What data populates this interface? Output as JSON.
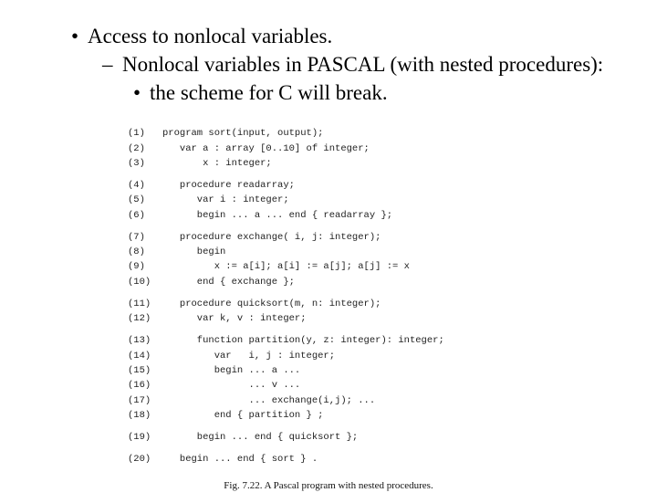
{
  "bullets": {
    "l1": "Access to nonlocal variables.",
    "l2": "Nonlocal variables in PASCAL (with nested procedures):",
    "l3": "the scheme for C will break."
  },
  "code": {
    "g1": [
      {
        "n": "(1)",
        "t": "program sort(input, output);"
      },
      {
        "n": "(2)",
        "t": "   var a : array [0..10] of integer;"
      },
      {
        "n": "(3)",
        "t": "       x : integer;"
      }
    ],
    "g2": [
      {
        "n": "(4)",
        "t": "   procedure readarray;"
      },
      {
        "n": "(5)",
        "t": "      var i : integer;"
      },
      {
        "n": "(6)",
        "t": "      begin ... a ... end { readarray };"
      }
    ],
    "g3": [
      {
        "n": "(7)",
        "t": "   procedure exchange( i, j: integer);"
      },
      {
        "n": "(8)",
        "t": "      begin"
      },
      {
        "n": "(9)",
        "t": "         x := a[i]; a[i] := a[j]; a[j] := x"
      },
      {
        "n": "(10)",
        "t": "      end { exchange };"
      }
    ],
    "g4": [
      {
        "n": "(11)",
        "t": "   procedure quicksort(m, n: integer);"
      },
      {
        "n": "(12)",
        "t": "      var k, v : integer;"
      }
    ],
    "g5": [
      {
        "n": "(13)",
        "t": "      function partition(y, z: integer): integer;"
      },
      {
        "n": "(14)",
        "t": "         var   i, j : integer;"
      },
      {
        "n": "(15)",
        "t": "         begin ... a ..."
      },
      {
        "n": "(16)",
        "t": "               ... v ..."
      },
      {
        "n": "(17)",
        "t": "               ... exchange(i,j); ..."
      },
      {
        "n": "(18)",
        "t": "         end { partition } ;"
      }
    ],
    "g6": [
      {
        "n": "(19)",
        "t": "      begin ... end { quicksort };"
      }
    ],
    "g7": [
      {
        "n": "(20)",
        "t": "   begin ... end { sort } ."
      }
    ]
  },
  "caption": "Fig. 7.22.  A Pascal program with nested procedures."
}
